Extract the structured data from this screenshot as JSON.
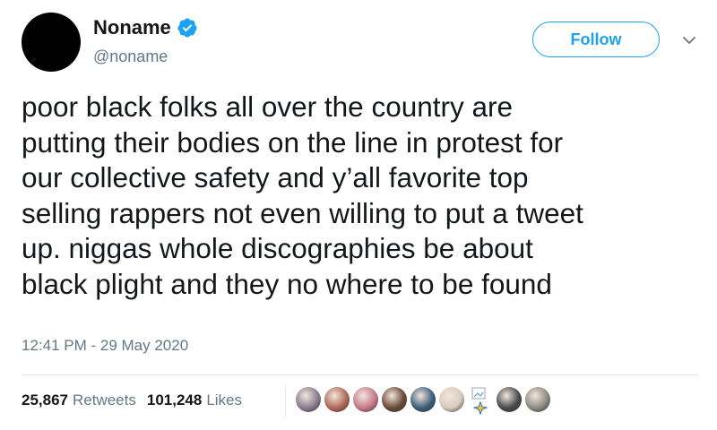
{
  "user": {
    "display_name": "Noname",
    "handle": "@noname",
    "verified_icon": "verified-badge-icon",
    "accent": "#1da1f2"
  },
  "actions": {
    "follow_label": "Follow",
    "more_icon": "chevron-down-icon"
  },
  "tweet": {
    "text_lines": [
      "poor black folks all over the country are",
      "putting their bodies on the line in protest for",
      "our collective safety and y’all favorite top",
      "selling rappers not even willing to put a tweet",
      "up. niggas whole discographies be about",
      "black plight and they no where to be found"
    ],
    "timestamp": "12:41 PM - 29 May 2020"
  },
  "stats": {
    "retweets_count": "25,867",
    "retweets_label": "Retweets",
    "likes_count": "101,248",
    "likes_label": "Likes"
  },
  "likers": [
    {
      "color": "#8a7d8f"
    },
    {
      "color": "#b06a58"
    },
    {
      "color": "#c77a8a"
    },
    {
      "color": "#6b4a3a"
    },
    {
      "color": "#3b5f7a"
    },
    {
      "color": "#d8cbbf"
    },
    {
      "color": "broken"
    },
    {
      "color": "#4a4a4a"
    },
    {
      "color": "#8f8a80"
    }
  ]
}
